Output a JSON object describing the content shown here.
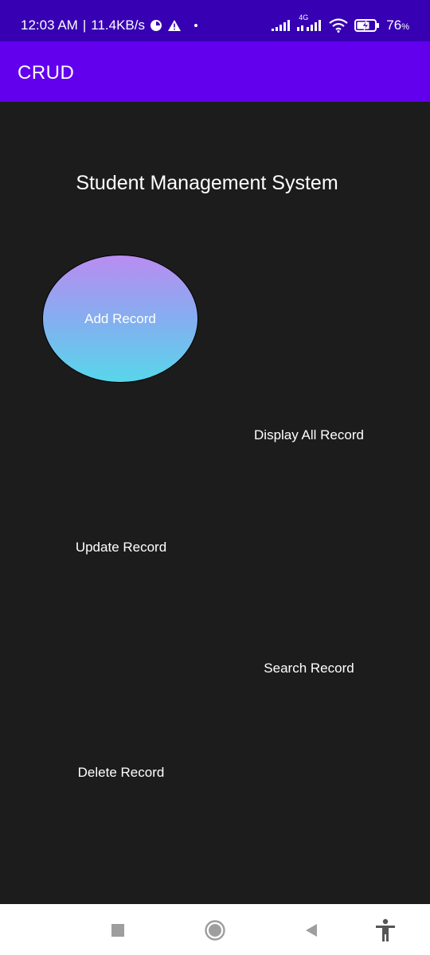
{
  "status_bar": {
    "time": "12:03 AM",
    "separator": "|",
    "network_speed": "11.4KB/s",
    "network_type": "4G",
    "battery_percent": "76",
    "battery_suffix": "%"
  },
  "app_bar": {
    "title": "CRUD"
  },
  "main": {
    "heading": "Student Management System",
    "buttons": {
      "add": "Add Record",
      "display": "Display All Record",
      "update": "Update Record",
      "search": "Search Record",
      "delete": "Delete Record"
    }
  },
  "colors": {
    "status_bar": "#3700b3",
    "app_bar": "#6200ee",
    "background": "#1c1c1c",
    "add_button_gradient": [
      "#b98cf1",
      "#58d6ea"
    ]
  },
  "icons": {
    "status": [
      "data-saver-icon",
      "warning-icon",
      "dot-icon",
      "signal-icon",
      "signal-4g-icon",
      "wifi-icon",
      "battery-charging-icon"
    ],
    "nav": [
      "recents-icon",
      "home-icon",
      "back-icon",
      "accessibility-icon"
    ]
  }
}
